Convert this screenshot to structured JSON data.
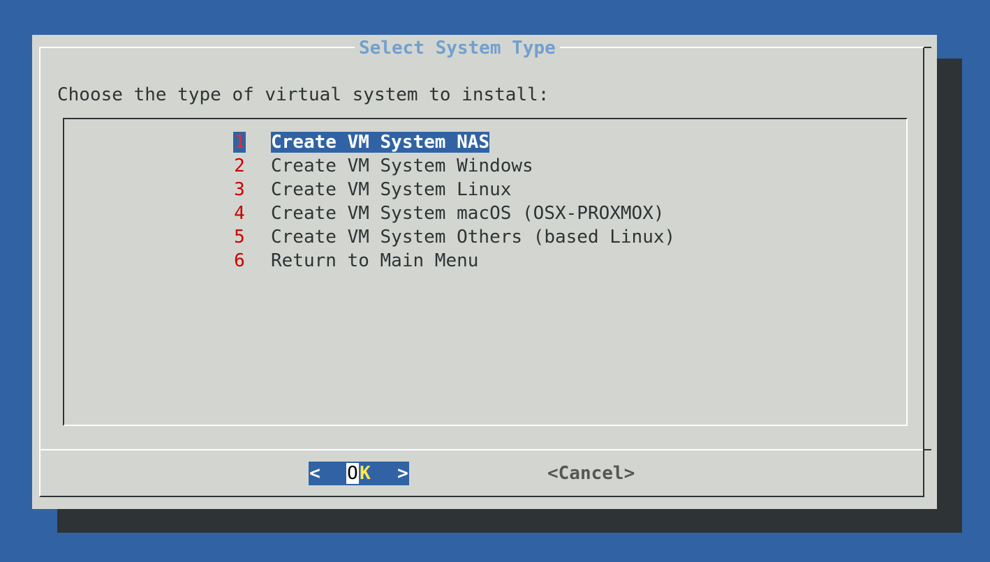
{
  "dialog": {
    "title": "Select System Type",
    "prompt": "Choose the type of virtual system to install:"
  },
  "menu": {
    "items": [
      {
        "num": "1",
        "label": "Create VM System NAS"
      },
      {
        "num": "2",
        "label": "Create VM System Windows"
      },
      {
        "num": "3",
        "label": "Create VM System Linux"
      },
      {
        "num": "4",
        "label": "Create VM System macOS (OSX-PROXMOX)"
      },
      {
        "num": "5",
        "label": "Create VM System Others (based Linux)"
      },
      {
        "num": "6",
        "label": "Return to Main Menu"
      }
    ],
    "selected_index": 0
  },
  "buttons": {
    "ok": {
      "left_bracket": "<",
      "hotkey": "O",
      "rest": "K",
      "right_bracket": ">"
    },
    "cancel": "<Cancel>"
  },
  "colors": {
    "background": "#3163a4",
    "dialog": "#d3d6d0",
    "title": "#729fcf",
    "menu_number": "#cc0000",
    "selection": "#3163a4",
    "button_hotkey_accent": "#fce94f"
  }
}
